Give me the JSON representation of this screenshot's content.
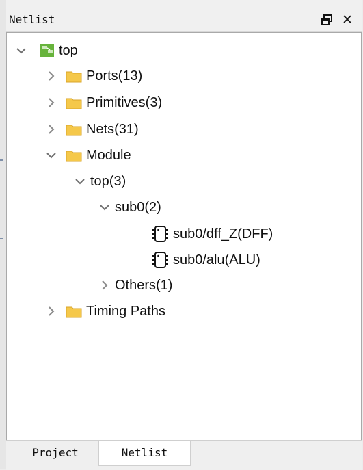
{
  "panel": {
    "title": "Netlist"
  },
  "tree": [
    {
      "label": "top"
    },
    {
      "label": "Ports(13)"
    },
    {
      "label": "Primitives(3)"
    },
    {
      "label": "Nets(31)"
    },
    {
      "label": "Module"
    },
    {
      "label": "top(3)"
    },
    {
      "label": "sub0(2)"
    },
    {
      "label": "sub0/dff_Z(DFF)"
    },
    {
      "label": "sub0/alu(ALU)"
    },
    {
      "label": "Others(1)"
    },
    {
      "label": "Timing Paths"
    }
  ],
  "tabs": [
    {
      "label": "Project",
      "active": false
    },
    {
      "label": "Netlist",
      "active": true
    }
  ],
  "colors": {
    "folder": "#f5c84a",
    "top_icon": "#67b33c",
    "chevron": "#6f6f6f"
  }
}
